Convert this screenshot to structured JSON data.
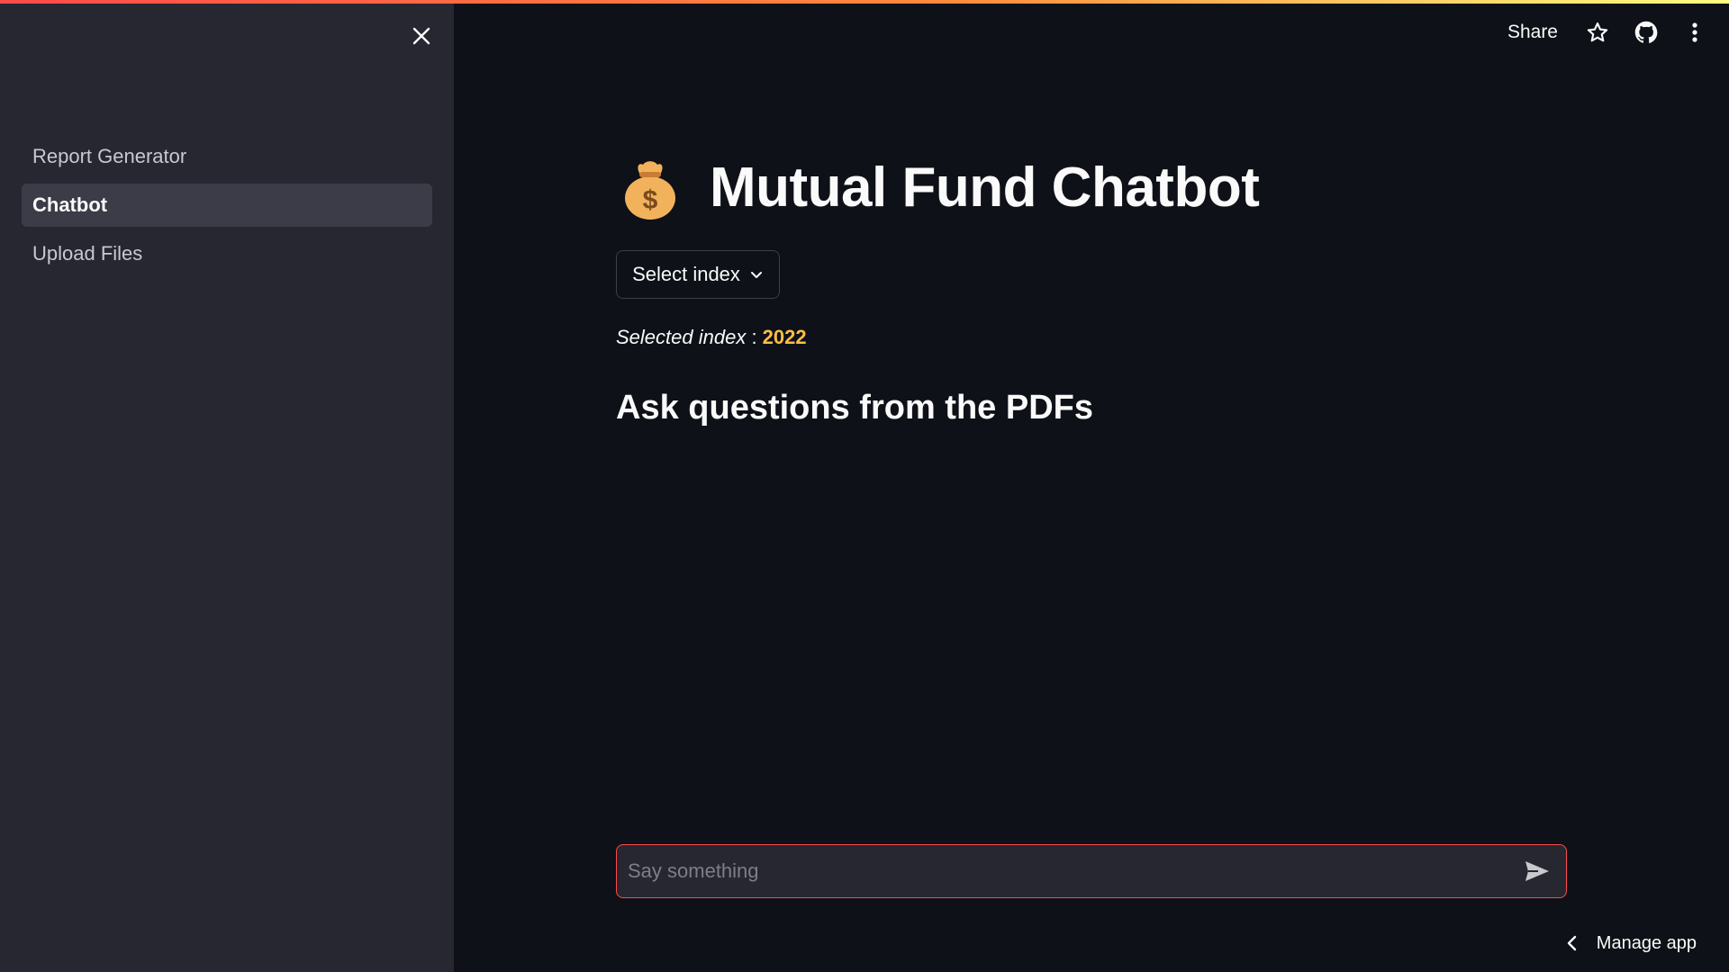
{
  "header": {
    "share_label": "Share",
    "icons": [
      "star-icon",
      "github-icon",
      "more-vertical-icon"
    ]
  },
  "sidebar": {
    "close_icon": "close-icon",
    "items": [
      {
        "label": "Report Generator",
        "active": false
      },
      {
        "label": "Chatbot",
        "active": true
      },
      {
        "label": "Upload Files",
        "active": false
      }
    ]
  },
  "main": {
    "title_icon": "money-bag-icon",
    "title": "Mutual Fund Chatbot",
    "select_label": "Select index",
    "selected_label": "Selected index",
    "selected_separator": " : ",
    "selected_value": "2022",
    "section_heading": "Ask questions from the PDFs"
  },
  "chat": {
    "placeholder": "Say something",
    "value": ""
  },
  "footer": {
    "manage_label": "Manage app"
  },
  "colors": {
    "background": "#0e1117",
    "sidebar": "#262730",
    "accent": "#ff4b4b",
    "selected_value": "#ffbd45"
  }
}
